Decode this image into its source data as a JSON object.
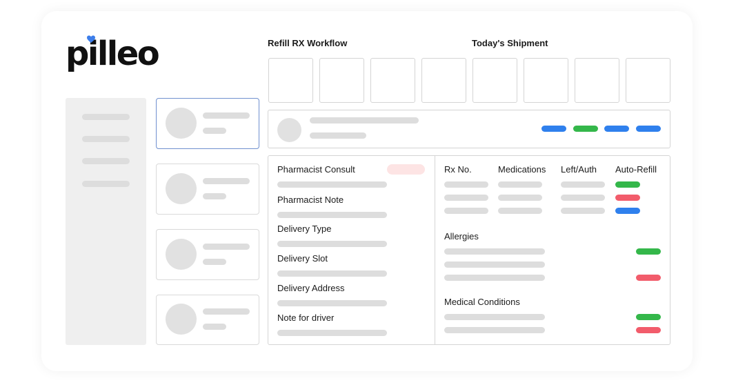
{
  "brand": {
    "name": "pilleo",
    "heart_color": "#3d7eea"
  },
  "headings": {
    "workflow": "Refill RX Workflow",
    "shipment": "Today's Shipment"
  },
  "left_panel": {
    "fields": [
      "Pharmacist Consult",
      "Pharmacist Note",
      "Delivery Type",
      "Delivery Slot",
      "Delivery Address",
      "Note for driver"
    ],
    "consult_badge_color": "#fde4e4"
  },
  "rx_table": {
    "headers": [
      "Rx No.",
      "Medications",
      "Left/Auth",
      "Auto-Refill"
    ],
    "auto_refill_status_colors": [
      "#34b74a",
      "#f25c6b",
      "#2f80ed"
    ]
  },
  "sections": {
    "allergies": "Allergies",
    "allergy_status_colors": [
      "#34b74a",
      "#f25c6b"
    ],
    "medical_conditions": "Medical Conditions",
    "condition_status_colors": [
      "#34b74a",
      "#f25c6b"
    ]
  },
  "patient_tag_colors": [
    "#2f80ed",
    "#34b74a",
    "#2f80ed",
    "#2f80ed"
  ],
  "colors": {
    "accent_blue": "#2f80ed",
    "green": "#34b74a",
    "red": "#f25c6b",
    "placeholder": "#dddddd"
  }
}
